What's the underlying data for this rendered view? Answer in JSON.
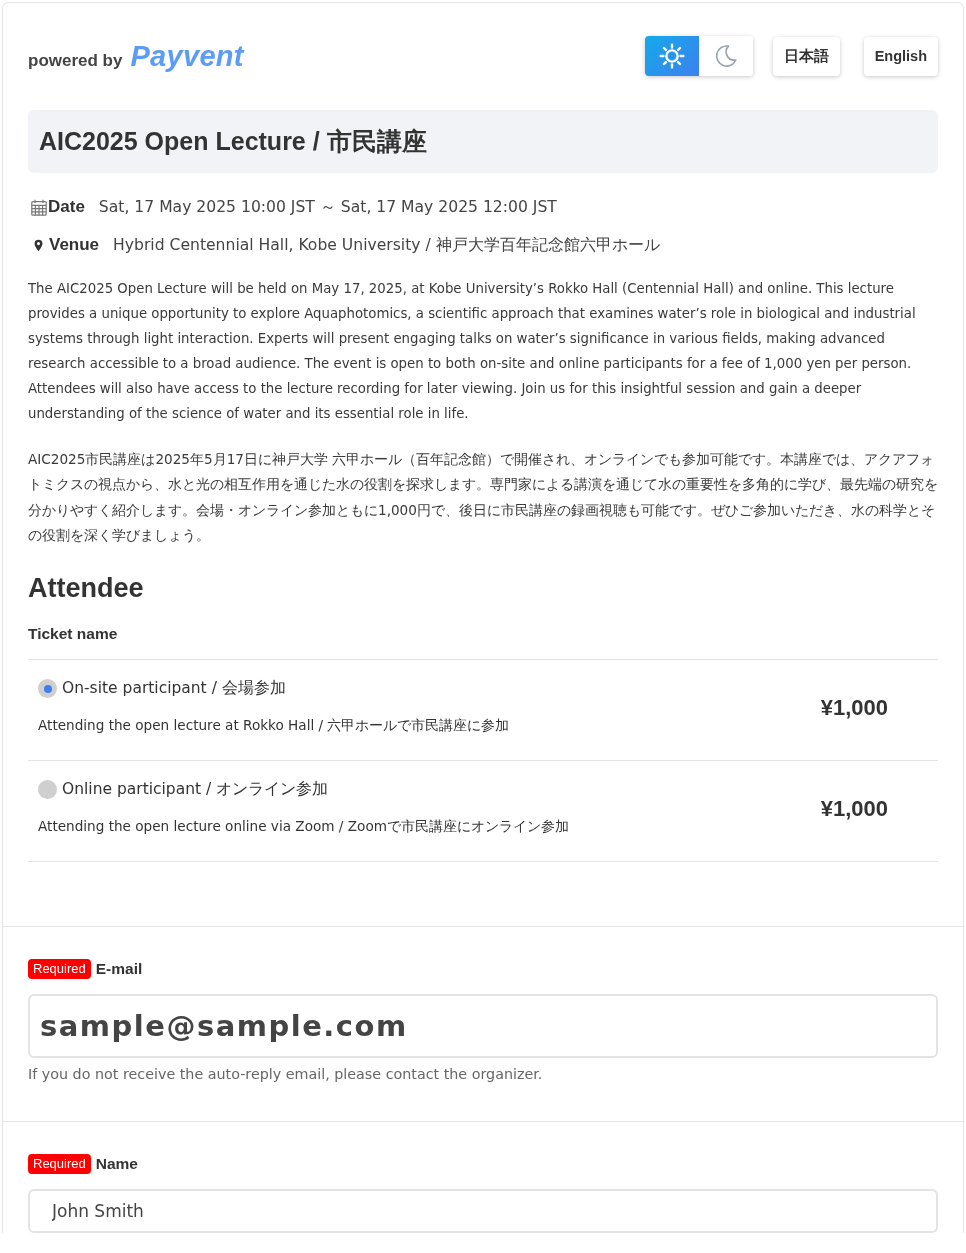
{
  "header": {
    "powered_by": "powered by",
    "logo": "Payvent",
    "theme_toggle": [
      {
        "kind": "light",
        "selected": true
      },
      {
        "kind": "dark",
        "selected": false
      }
    ],
    "language_buttons": [
      {
        "label": "日本語"
      },
      {
        "label": "English"
      }
    ]
  },
  "event": {
    "title": "AIC2025 Open Lecture / 市民講座",
    "details": [
      {
        "kind": "date",
        "label": "Date",
        "value": "Sat, 17 May 2025 10:00 JST ～ Sat, 17 May 2025 12:00 JST"
      },
      {
        "kind": "venue",
        "label": "Venue",
        "value": "Hybrid Centennial Hall, Kobe University / 神戸大学百年記念館六甲ホール"
      }
    ],
    "description": [
      "The AIC2025 Open Lecture will be held on May 17, 2025, at Kobe University’s Rokko Hall (Centennial Hall) and online. This lecture provides a unique opportunity to explore Aquaphotomics, a scientific approach that examines water’s role in biological and industrial systems through light interaction. Experts will present engaging talks on water’s significance in various fields, making advanced research accessible to a broad audience. The event is open to both on-site and online participants for a fee of 1,000 yen per person. Attendees will also have access to the lecture recording for later viewing. Join us for this insightful session and gain a deeper understanding of the science of water and its essential role in life.",
      "AIC2025市民講座は2025年5月17日に神戸大学 六甲ホール（百年記念館）で開催され、オンラインでも参加可能です。本講座では、アクアフォトミクスの視点から、水と光の相互作用を通じた水の役割を探求します。専門家による講演を通じて水の重要性を多角的に学び、最先端の研究を分かりやすく紹介します。会場・オンライン参加ともに1,000円で、後日に市民講座の録画視聴も可能です。ぜひご参加いただき、水の科学とその役割を深く学びましょう。"
    ]
  },
  "attendee": {
    "heading": "Attendee",
    "column": "Ticket name",
    "tickets": [
      {
        "name": "On-site participant / 会場参加",
        "description": "Attending the open lecture at Rokko Hall / 六甲ホールで市民講座に参加",
        "price": "¥1,000",
        "selected": true
      },
      {
        "name": "Online participant / オンライン参加",
        "description": "Attending the open lecture online via Zoom / Zoomで市民講座にオンライン参加",
        "price": "¥1,000",
        "selected": false
      }
    ]
  },
  "form": {
    "fields": [
      {
        "kind": "email",
        "badge": "Required",
        "label": "E-mail",
        "value": "sample@sample.com",
        "hint": "If you do not receive the auto-reply email, please contact the organizer."
      },
      {
        "kind": "text",
        "badge": "Required",
        "label": "Name",
        "value": "John Smith"
      }
    ]
  }
}
